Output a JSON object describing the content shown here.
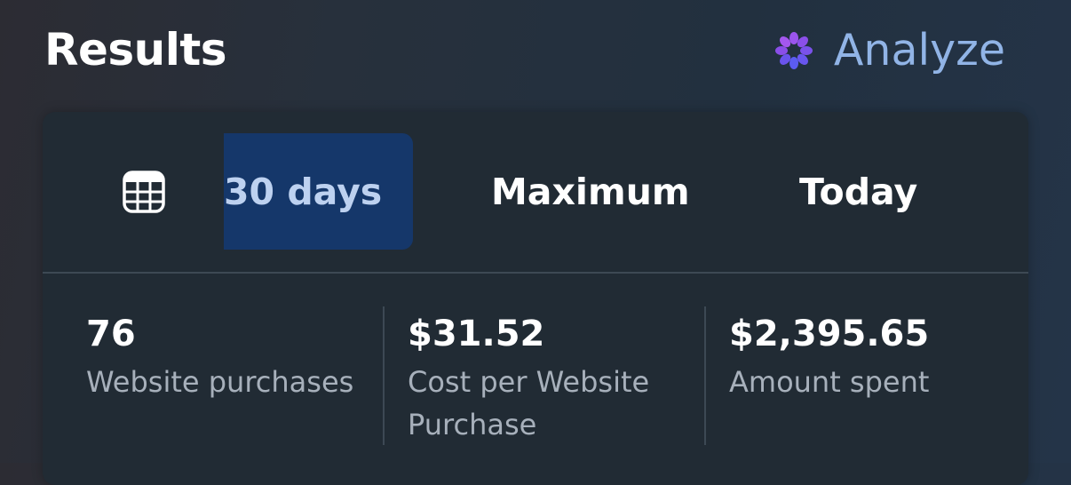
{
  "header": {
    "title": "Results",
    "analyze_label": "Analyze",
    "analyze_icon": "sparkle-icon"
  },
  "date_range": {
    "calendar_icon": "calendar-icon",
    "tabs": [
      {
        "label": "30 days",
        "selected": true
      },
      {
        "label": "Maximum",
        "selected": false
      },
      {
        "label": "Today",
        "selected": false
      }
    ]
  },
  "metrics": [
    {
      "value": "76",
      "label": "Website purchases"
    },
    {
      "value": "$31.52",
      "label": "Cost per Website Purchase"
    },
    {
      "value": "$2,395.65",
      "label": "Amount spent"
    }
  ],
  "colors": {
    "accent_text": "#91b4e6",
    "selected_tab_bg": "#15376a",
    "card_bg": "#212b34",
    "sparkle_purple": "#8a4be8",
    "sparkle_blue": "#5a5cf0"
  }
}
